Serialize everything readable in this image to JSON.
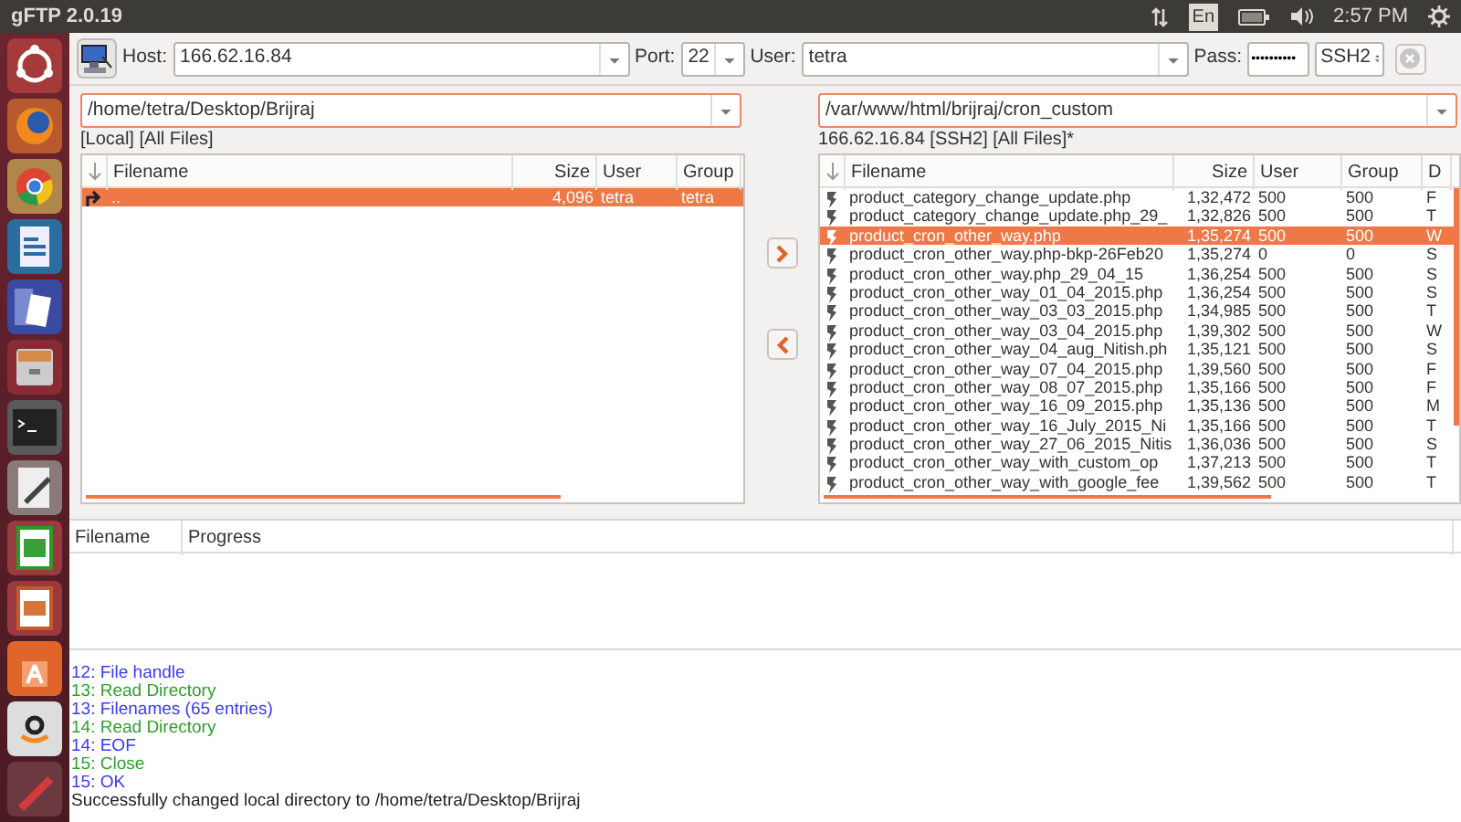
{
  "top_bar": {
    "app_title": "gFTP 2.0.19",
    "keyboard": "En",
    "clock": "2:57 PM"
  },
  "toolbar": {
    "host_label": "Host:",
    "host": "166.62.16.84",
    "port_label": "Port:",
    "port": "22",
    "user_label": "User:",
    "user": "tetra",
    "pass_label": "Pass:",
    "password": "••••••••••",
    "protocol": "SSH2",
    "stop_disabled": true
  },
  "local": {
    "path": "/home/tetra/Desktop/Brijraj",
    "status": "[Local] [All Files]",
    "columns": [
      "Filename",
      "Size",
      "User",
      "Group"
    ],
    "rows": [
      {
        "name": "..",
        "size": "4,096",
        "user": "tetra",
        "group": "tetra",
        "selected": true
      }
    ]
  },
  "remote": {
    "path": "/var/www/html/brijraj/cron_custom",
    "status": "166.62.16.84 [SSH2] [All Files]*",
    "columns": [
      "Filename",
      "Size",
      "User",
      "Group",
      "D"
    ],
    "rows": [
      {
        "name": "product_category_change_update.php",
        "size": "1,32,472",
        "user": "500",
        "group": "500",
        "column_5": "F",
        "selected": false
      },
      {
        "name": "product_category_change_update.php_29_",
        "size": "1,32,826",
        "user": "500",
        "group": "500",
        "column_5": "T",
        "selected": false
      },
      {
        "name": "product_cron_other_way.php",
        "size": "1,35,274",
        "user": "500",
        "group": "500",
        "column_5": "W",
        "selected": true
      },
      {
        "name": "product_cron_other_way.php-bkp-26Feb20",
        "size": "1,35,274",
        "user": "0",
        "group": "0",
        "column_5": "S",
        "selected": false
      },
      {
        "name": "product_cron_other_way.php_29_04_15",
        "size": "1,36,254",
        "user": "500",
        "group": "500",
        "column_5": "S",
        "selected": false
      },
      {
        "name": "product_cron_other_way_01_04_2015.php",
        "size": "1,36,254",
        "user": "500",
        "group": "500",
        "column_5": "S",
        "selected": false
      },
      {
        "name": "product_cron_other_way_03_03_2015.php",
        "size": "1,34,985",
        "user": "500",
        "group": "500",
        "column_5": "T",
        "selected": false
      },
      {
        "name": "product_cron_other_way_03_04_2015.php",
        "size": "1,39,302",
        "user": "500",
        "group": "500",
        "column_5": "W",
        "selected": false
      },
      {
        "name": "product_cron_other_way_04_aug_Nitish.ph",
        "size": "1,35,121",
        "user": "500",
        "group": "500",
        "column_5": "S",
        "selected": false
      },
      {
        "name": "product_cron_other_way_07_04_2015.php",
        "size": "1,39,560",
        "user": "500",
        "group": "500",
        "column_5": "F",
        "selected": false
      },
      {
        "name": "product_cron_other_way_08_07_2015.php",
        "size": "1,35,166",
        "user": "500",
        "group": "500",
        "column_5": "F",
        "selected": false
      },
      {
        "name": "product_cron_other_way_16_09_2015.php",
        "size": "1,35,136",
        "user": "500",
        "group": "500",
        "column_5": "M",
        "selected": false
      },
      {
        "name": "product_cron_other_way_16_July_2015_Ni",
        "size": "1,35,166",
        "user": "500",
        "group": "500",
        "column_5": "T",
        "selected": false
      },
      {
        "name": "product_cron_other_way_27_06_2015_Nitis",
        "size": "1,36,036",
        "user": "500",
        "group": "500",
        "column_5": "S",
        "selected": false
      },
      {
        "name": "product_cron_other_way_with_custom_op",
        "size": "1,37,213",
        "user": "500",
        "group": "500",
        "column_5": "T",
        "selected": false
      },
      {
        "name": "product_cron_other_way_with_google_fee",
        "size": "1,39,562",
        "user": "500",
        "group": "500",
        "column_5": "T",
        "selected": false
      }
    ]
  },
  "transfers": {
    "columns": [
      "Filename",
      "Progress"
    ]
  },
  "log": [
    {
      "kind": "response",
      "text": "12: File handle"
    },
    {
      "kind": "command",
      "text": "13: Read Directory"
    },
    {
      "kind": "response",
      "text": "13: Filenames (65 entries)"
    },
    {
      "kind": "command",
      "text": "14: Read Directory"
    },
    {
      "kind": "response",
      "text": "14: EOF"
    },
    {
      "kind": "command",
      "text": "15: Close"
    },
    {
      "kind": "response",
      "text": "15: OK"
    },
    {
      "kind": "info",
      "text": "Successfully changed local directory to /home/tetra/Desktop/Brijraj"
    }
  ]
}
